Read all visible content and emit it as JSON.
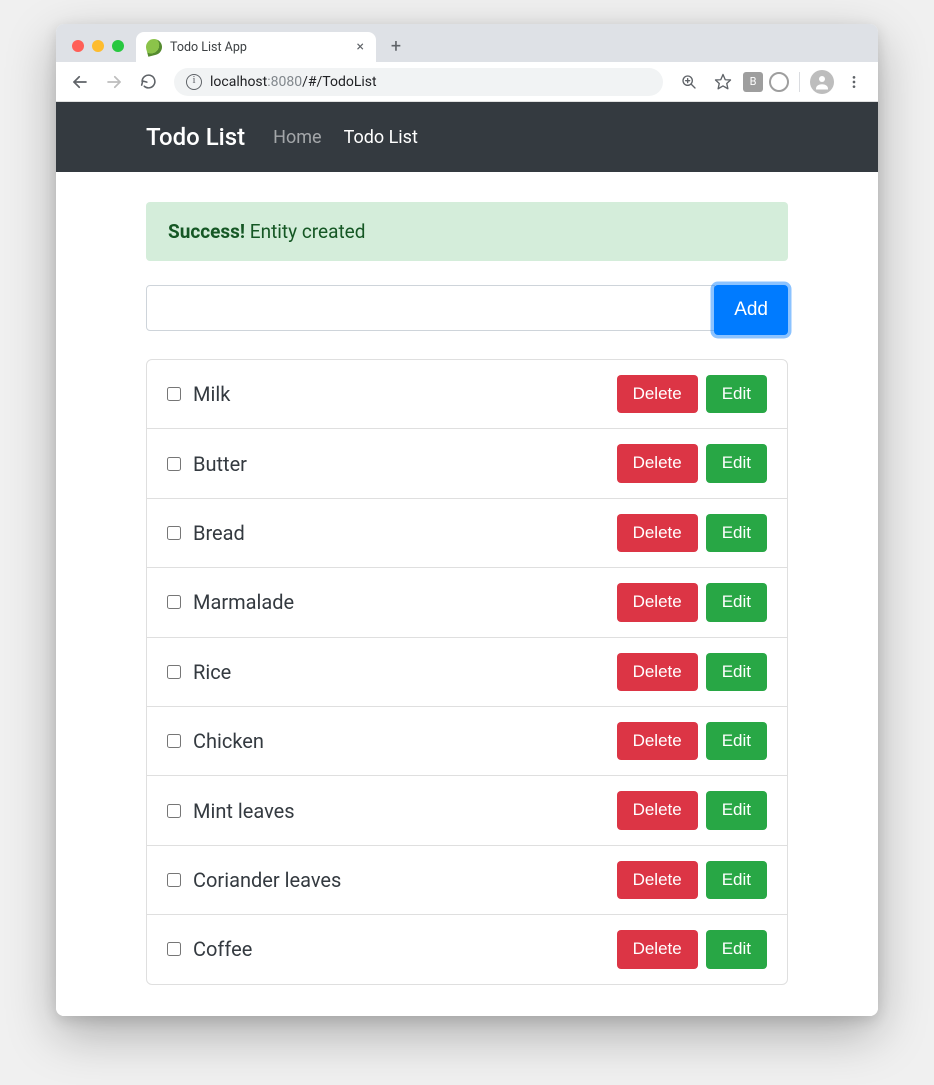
{
  "browser": {
    "tab_title": "Todo List App",
    "url_prefix": "localhost",
    "url_dim": ":8080",
    "url_suffix": "/#/TodoList"
  },
  "navbar": {
    "brand": "Todo List",
    "links": [
      {
        "label": "Home",
        "active": false
      },
      {
        "label": "Todo List",
        "active": true
      }
    ]
  },
  "alert": {
    "strong": "Success!",
    "message": " Entity created"
  },
  "input": {
    "value": "",
    "add_label": "Add"
  },
  "buttons": {
    "delete": "Delete",
    "edit": "Edit"
  },
  "items": [
    {
      "label": "Milk",
      "checked": false
    },
    {
      "label": "Butter",
      "checked": false
    },
    {
      "label": "Bread",
      "checked": false
    },
    {
      "label": "Marmalade",
      "checked": false
    },
    {
      "label": "Rice",
      "checked": false
    },
    {
      "label": "Chicken",
      "checked": false
    },
    {
      "label": "Mint leaves",
      "checked": false
    },
    {
      "label": "Coriander leaves",
      "checked": false
    },
    {
      "label": "Coffee",
      "checked": false
    }
  ]
}
